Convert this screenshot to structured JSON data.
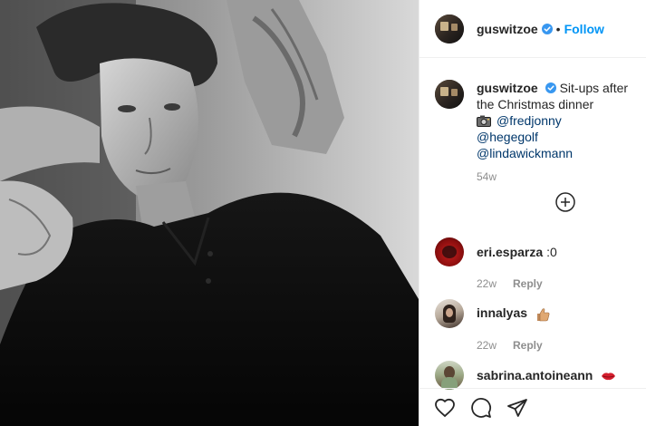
{
  "post": {
    "username": "guswitzoe",
    "follow_label": "Follow",
    "separator": "•",
    "caption": "Sit-ups after the Christmas dinner",
    "mentions": [
      "@fredjonny",
      "@hegegolf",
      "@lindawickmann"
    ],
    "time": "54w"
  },
  "comments": [
    {
      "username": "eri.esparza",
      "text": ":0",
      "time": "22w",
      "reply_label": "Reply",
      "emoji": ""
    },
    {
      "username": "innalyas",
      "text": "",
      "time": "22w",
      "reply_label": "Reply",
      "emoji": "thumbs-up"
    },
    {
      "username": "sabrina.antoineann",
      "text": "",
      "time": "",
      "reply_label": "",
      "emoji": "kiss-lips"
    }
  ],
  "icons": {
    "verified": "verified-badge-icon",
    "camera": "camera-icon",
    "load_more": "plus-circle-icon",
    "like": "heart-icon",
    "comment": "comment-icon",
    "share": "share-icon"
  },
  "colors": {
    "accent": "#0095f6",
    "mention": "#00376b",
    "muted": "#8e8e8e",
    "text": "#262626"
  }
}
